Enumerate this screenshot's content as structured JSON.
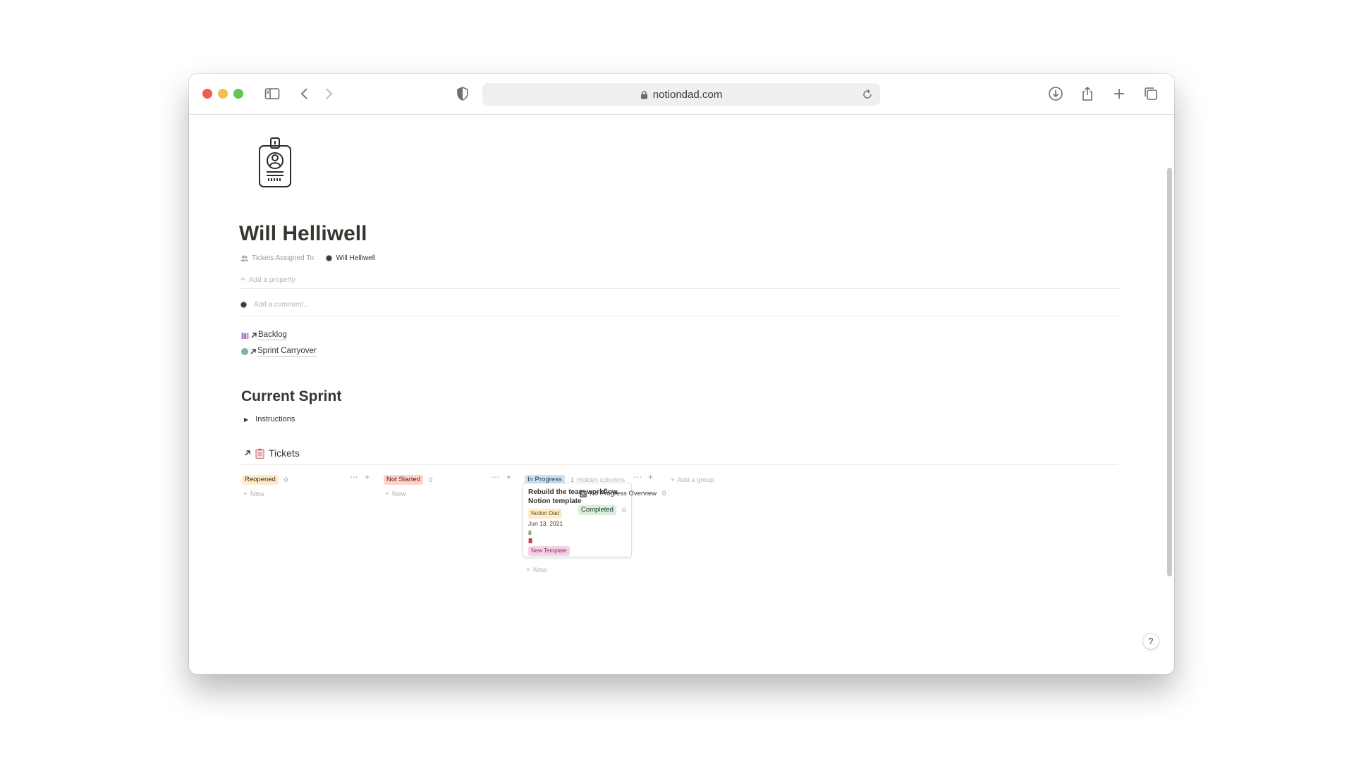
{
  "browser": {
    "url": "notiondad.com"
  },
  "page": {
    "title": "Will Helliwell",
    "property_label": "Tickets Assigned To:",
    "property_value": "Will Helliwell",
    "add_property": "Add a property",
    "comment_placeholder": "Add a comment...",
    "links": [
      {
        "label": "Backlog",
        "icon": "books-icon"
      },
      {
        "label": "Sprint Carryover",
        "icon": "green-circle-icon"
      }
    ],
    "section_heading": "Current Sprint",
    "toggle_label": "Instructions",
    "database_title": "Tickets"
  },
  "board": {
    "columns": [
      {
        "label": "Reopened",
        "count": "0",
        "color": "#fdecc8",
        "text_color": "#402c1b"
      },
      {
        "label": "Not Started",
        "count": "0",
        "color": "#ffe2dd",
        "text_color": "#5d1715"
      },
      {
        "label": "In Progress",
        "count": "1",
        "color": "#d3e5ef",
        "text_color": "#183347"
      }
    ],
    "new_label": "New",
    "card": {
      "title": "Rebuild the team workflow Notion template",
      "tag1": "Notion Dad",
      "date": "Jun 13, 2021",
      "number": "8",
      "bars": "III",
      "tag2": "New Template"
    },
    "hidden_columns_label": "Hidden columns",
    "add_group": "Add a group",
    "hidden_columns": [
      {
        "label": "No Progress Overview",
        "count": "0"
      },
      {
        "label": "Completed",
        "count": "0",
        "color": "#dbeddb"
      }
    ]
  },
  "help_label": "?"
}
